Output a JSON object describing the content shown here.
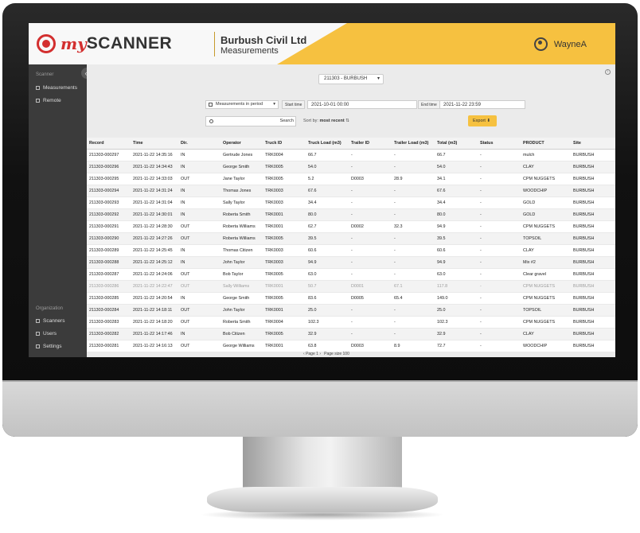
{
  "app": {
    "logo_my": "my",
    "logo_scanner": "SCANNER",
    "company": "Burbush Civil Ltd",
    "section": "Measurements",
    "user_name": "WayneA"
  },
  "colors": {
    "accent": "#f6c140",
    "logo_red": "#d32f2f",
    "sidebar": "#3b3b3b"
  },
  "sidebar": {
    "collapse": "«",
    "scanner_heading": "Scanner",
    "items_top": [
      {
        "label": "Measurements",
        "icon": "grid-icon"
      },
      {
        "label": "Remote",
        "icon": "monitor-icon"
      }
    ],
    "org_heading": "Organization",
    "items_bottom": [
      {
        "label": "Scanners",
        "icon": "scanner-icon"
      },
      {
        "label": "Users",
        "icon": "users-icon"
      },
      {
        "label": "Settings",
        "icon": "gear-icon"
      }
    ]
  },
  "toolbar": {
    "scanner_select": "211303 - BURBUSH",
    "info": "i",
    "period_select": "Measurements in period",
    "start_label": "Start time",
    "start_value": "2021-10-01 00:00",
    "end_label": "End time",
    "end_value": "2021-11-22 23:59",
    "search_placeholder": "",
    "search_button": "Search",
    "sort_prefix": "Sort by:",
    "sort_value": "most recent",
    "export_label": "Export"
  },
  "table": {
    "columns": [
      "Record",
      "Time",
      "Dir.",
      "Operator",
      "Truck ID",
      "Truck Load (m3)",
      "Trailer ID",
      "Trailer Load (m3)",
      "Total (m3)",
      "Status",
      "PRODUCT",
      "Site"
    ],
    "rows": [
      [
        "211303-000297",
        "2021-11-22 14:35:16",
        "IN",
        "Gertrude Jones",
        "TRK0004",
        "66.7",
        "-",
        "-",
        "66.7",
        "-",
        "mulch",
        "BURBUSH"
      ],
      [
        "211303-000296",
        "2021-11-22 14:34:43",
        "IN",
        "George Smith",
        "TRK0005",
        "54.0",
        "-",
        "-",
        "54.0",
        "-",
        "CLAY",
        "BURBUSH"
      ],
      [
        "211303-000295",
        "2021-11-22 14:33:03",
        "OUT",
        "Jane Taylor",
        "TRK0005",
        "5.2",
        "D0003",
        "28.9",
        "34.1",
        "-",
        "CPM NUGGETS",
        "BURBUSH"
      ],
      [
        "211303-000294",
        "2021-11-22 14:31:24",
        "IN",
        "Thomas Jones",
        "TRK0003",
        "67.6",
        "-",
        "-",
        "67.6",
        "-",
        "WOODCHIP",
        "BURBUSH"
      ],
      [
        "211303-000293",
        "2021-11-22 14:31:04",
        "IN",
        "Sally Taylor",
        "TRK0003",
        "34.4",
        "-",
        "-",
        "34.4",
        "-",
        "GOLD",
        "BURBUSH"
      ],
      [
        "211303-000292",
        "2021-11-22 14:30:01",
        "IN",
        "Roberta Smith",
        "TRK0001",
        "80.0",
        "-",
        "-",
        "80.0",
        "-",
        "GOLD",
        "BURBUSH"
      ],
      [
        "211303-000291",
        "2021-11-22 14:28:30",
        "OUT",
        "Roberta Williams",
        "TRK0001",
        "62.7",
        "D0002",
        "32.3",
        "94.9",
        "-",
        "CPM NUGGETS",
        "BURBUSH"
      ],
      [
        "211303-000290",
        "2021-11-22 14:27:26",
        "OUT",
        "Roberta Williams",
        "TRK0005",
        "39.5",
        "-",
        "-",
        "39.5",
        "-",
        "TOPSOIL",
        "BURBUSH"
      ],
      [
        "211303-000289",
        "2021-11-22 14:25:45",
        "IN",
        "Thomas Citizen",
        "TRK0003",
        "60.6",
        "-",
        "-",
        "60.6",
        "-",
        "CLAY",
        "BURBUSH"
      ],
      [
        "211303-000288",
        "2021-11-22 14:25:12",
        "IN",
        "John Taylor",
        "TRK0003",
        "94.9",
        "-",
        "-",
        "94.9",
        "-",
        "Mix #2",
        "BURBUSH"
      ],
      [
        "211303-000287",
        "2021-11-22 14:24:06",
        "OUT",
        "Bob Taylor",
        "TRK0005",
        "63.0",
        "-",
        "-",
        "63.0",
        "-",
        "Clear gravel",
        "BURBUSH"
      ],
      [
        "211303-000286",
        "2021-11-22 14:22:47",
        "OUT",
        "Sally Williams",
        "TRK0001",
        "50.7",
        "D0001",
        "67.1",
        "117.8",
        "-",
        "CPM NUGGETS",
        "BURBUSH"
      ],
      [
        "211303-000285",
        "2021-11-22 14:20:54",
        "IN",
        "George Smith",
        "TRK0005",
        "83.6",
        "D0005",
        "65.4",
        "149.0",
        "-",
        "CPM NUGGETS",
        "BURBUSH"
      ],
      [
        "211303-000284",
        "2021-11-22 14:18:11",
        "OUT",
        "John Taylor",
        "TRK0001",
        "25.0",
        "-",
        "-",
        "25.0",
        "-",
        "TOPSOIL",
        "BURBUSH"
      ],
      [
        "211303-000283",
        "2021-11-22 14:18:20",
        "OUT",
        "Roberta Smith",
        "TRK0004",
        "102.3",
        "-",
        "-",
        "102.3",
        "-",
        "CPM NUGGETS",
        "BURBUSH"
      ],
      [
        "211303-000282",
        "2021-11-22 14:17:46",
        "IN",
        "Bob Citizen",
        "TRK0005",
        "32.9",
        "-",
        "-",
        "32.9",
        "-",
        "CLAY",
        "BURBUSH"
      ],
      [
        "211303-000281",
        "2021-11-22 14:16:13",
        "OUT",
        "George Williams",
        "TRK0001",
        "63.8",
        "D0003",
        "8.9",
        "72.7",
        "-",
        "WOODCHIP",
        "BURBUSH"
      ]
    ],
    "faded_row": 11
  },
  "pager": {
    "prev": "‹",
    "page_label": "Page",
    "page": "1",
    "next": "›",
    "size_label": "Page size",
    "size": "100"
  }
}
